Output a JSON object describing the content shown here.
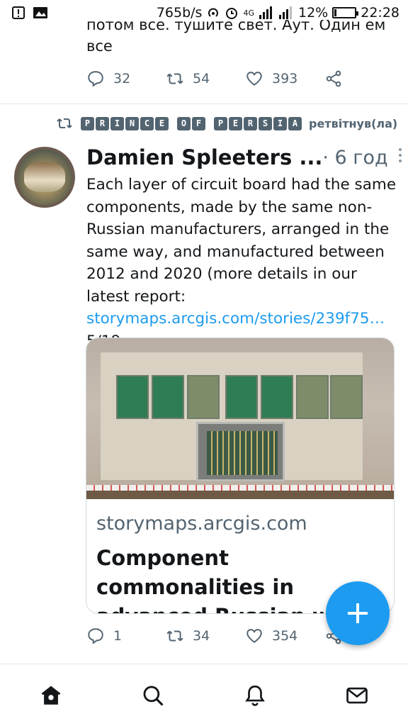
{
  "status_bar": {
    "speed": "765b/s",
    "network": "4G",
    "battery": "12%",
    "battery_level": 0.12,
    "time": "22:28"
  },
  "previous_tweet": {
    "text_cut": "потом все. тушите свет. Аут. Один ем",
    "text_line": "все",
    "replies": "32",
    "retweets": "54",
    "likes": "393"
  },
  "retweet_context": {
    "retweeter": "PRINCE OF PERSIA",
    "retweeter_letters_1": [
      "P",
      "R",
      "I",
      "N",
      "C",
      "E"
    ],
    "retweeter_letters_2": [
      "O",
      "F"
    ],
    "retweeter_letters_3": [
      "P",
      "E",
      "R",
      "S",
      "I",
      "A"
    ],
    "label": "ретвітнув(ла)"
  },
  "tweet": {
    "author": "Damien Spleeters ...",
    "time": "· 6 год",
    "text_before_link": "Each layer of circuit board had the same components, made by the same non-Russian manufacturers, arranged in the same way, and manufactured between 2012 and 2020 (more details in our latest report: ",
    "link_text": "storymaps.arcgis.com/stories/239f75…",
    "text_after_link": " 5/19",
    "card": {
      "domain": "storymaps.arcgis.com",
      "title": "Component commonalities in advanced Russian we"
    },
    "replies": "1",
    "retweets": "34",
    "likes": "354"
  },
  "colors": {
    "accent": "#1d9bf0",
    "muted": "#536471",
    "text": "#14171a"
  },
  "nav": {
    "items": [
      "home-icon",
      "search-icon",
      "notifications-icon",
      "messages-icon"
    ]
  }
}
